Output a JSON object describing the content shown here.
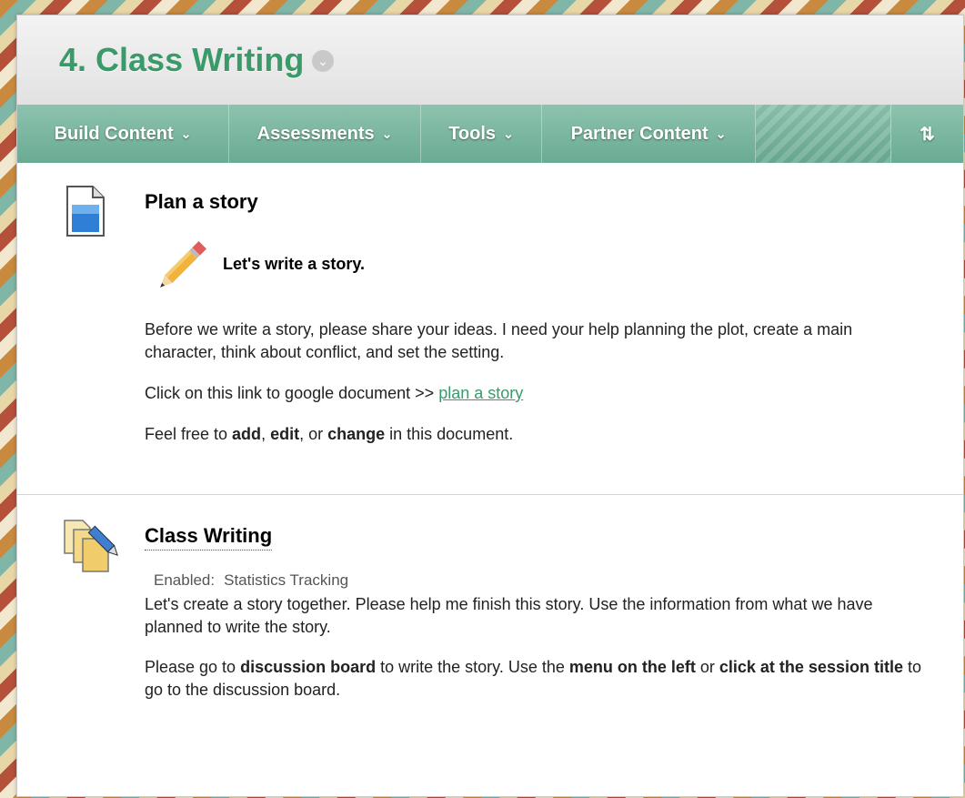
{
  "header": {
    "title": "4. Class Writing"
  },
  "toolbar": {
    "buttons": [
      {
        "label": "Build Content"
      },
      {
        "label": "Assessments"
      },
      {
        "label": "Tools"
      },
      {
        "label": "Partner Content"
      }
    ],
    "reorder_label": "⇅"
  },
  "items": [
    {
      "icon": "document-icon",
      "title": "Plan a story",
      "lead": "Let's write a story.",
      "para1": "Before we write a story, please share your ideas. I need your help planning the plot, create a main character, think about conflict, and set the setting.",
      "para2_prefix": "Click on this link to google document >> ",
      "para2_link": "plan a story",
      "para3": {
        "t1": "Feel free to ",
        "b1": "add",
        "t2": ", ",
        "b2": "edit",
        "t3": ", or ",
        "b3": "change",
        "t4": " in this document."
      }
    },
    {
      "icon": "discussion-forum-icon",
      "title": "Class Writing",
      "enabled_label": "Enabled:",
      "enabled_value": "Statistics Tracking",
      "para1": "Let's create a story together. Please help me finish this story. Use the information from what we have planned to write the story.",
      "para2": {
        "t1": "Please go to ",
        "b1": "discussion board",
        "t2": " to write the story. Use the ",
        "b2": "menu on the left",
        "t3": " or ",
        "b3": "click at the session title",
        "t4": " to go to the discussion board."
      }
    }
  ]
}
